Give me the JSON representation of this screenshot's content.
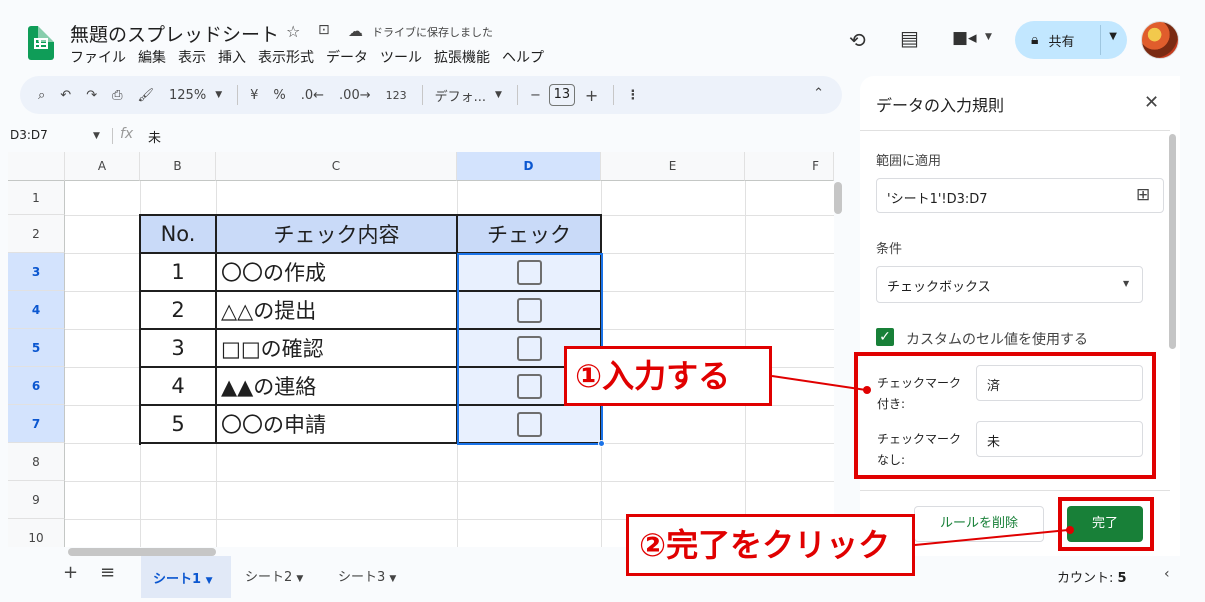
{
  "header": {
    "title": "無題のスプレッドシート",
    "saved_status": "ドライブに保存しました",
    "menu": [
      "ファイル",
      "編集",
      "表示",
      "挿入",
      "表示形式",
      "データ",
      "ツール",
      "拡張機能",
      "ヘルプ"
    ],
    "share_label": "共有"
  },
  "toolbar": {
    "zoom": "125%",
    "currency": "¥",
    "percent": "%",
    "dec_decrease": ".0←",
    "dec_increase": ".00→",
    "number_format": "123",
    "font": "デフォ...",
    "minus": "−",
    "font_size": "13",
    "plus": "+"
  },
  "formula_bar": {
    "range": "D3:D7",
    "fx": "fx",
    "value": "未"
  },
  "grid": {
    "columns": [
      "A",
      "B",
      "C",
      "D",
      "E",
      "F"
    ],
    "rows": [
      "1",
      "2",
      "3",
      "4",
      "5",
      "6",
      "7",
      "8",
      "9",
      "10"
    ],
    "table_headers": [
      "No.",
      "チェック内容",
      "チェック"
    ],
    "table_rows": [
      {
        "no": "1",
        "content": "〇〇の作成"
      },
      {
        "no": "2",
        "content": "△△の提出"
      },
      {
        "no": "3",
        "content": "□□の確認"
      },
      {
        "no": "4",
        "content": "▲▲の連絡"
      },
      {
        "no": "5",
        "content": "〇〇の申請"
      }
    ]
  },
  "sheets": {
    "add": "+",
    "list": "≡",
    "tabs": [
      "シート1",
      "シート2",
      "シート3"
    ],
    "count_label": "カウント: ",
    "count_value": "5"
  },
  "panel": {
    "title": "データの入力規則",
    "range_label": "範囲に適用",
    "range_value": "'シート1'!D3:D7",
    "condition_label": "条件",
    "condition_value": "チェックボックス",
    "custom_label": "カスタムのセル値を使用する",
    "checked_label_1": "チェックマーク",
    "checked_label_2": "付き:",
    "checked_value": "済",
    "unchecked_label_1": "チェックマーク",
    "unchecked_label_2": "なし:",
    "unchecked_value": "未",
    "remove_label": "ルールを削除",
    "done_label": "完了"
  },
  "annotations": {
    "step1": "①入力する",
    "step2": "②完了をクリック",
    "color": "#e00000"
  }
}
